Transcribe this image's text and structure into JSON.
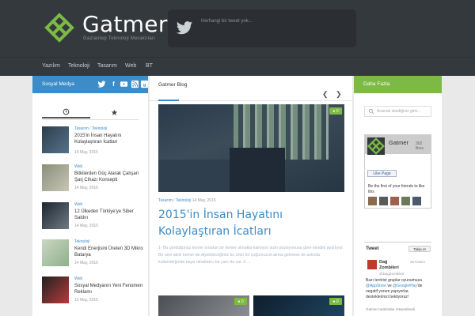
{
  "header": {
    "brand": "Gatmer",
    "tagline": "Gaziantep Teknoloji Meraklıları",
    "tweet": "Herhangi bir tweet yok..."
  },
  "nav": [
    "Yazılım",
    "Teknoloji",
    "Tasarım",
    "Web",
    "BT"
  ],
  "left": {
    "title": "Sosyal Medya",
    "social_icons": [
      "twitter-icon",
      "facebook-icon",
      "youtube-icon",
      "rss-icon",
      "google-plus-icon"
    ],
    "tabs": [
      "clock-icon",
      "star-icon"
    ],
    "posts": [
      {
        "cat_a": "Tasarım",
        "sep": " / ",
        "cat_b": "Teknoloji",
        "title": "2015'in İnsan Hayatını Kolaylaştıran İcatları",
        "date": "14 May, 2015"
      },
      {
        "cat_a": "Web",
        "sep": "",
        "cat_b": "",
        "title": "Bitkilerden Güç Alarak Çalışan Şarj Cihazı Konsepti",
        "date": "14 May, 2015"
      },
      {
        "cat_a": "Web",
        "sep": "",
        "cat_b": "",
        "title": "12 Ülkeden Türkiye'ye Siber Saldırı",
        "date": "14 May, 2015"
      },
      {
        "cat_a": "Teknoloji",
        "sep": "",
        "cat_b": "",
        "title": "Kendi Enerjisini Üreten 3D Mikro Batarya",
        "date": "14 May, 2015"
      },
      {
        "cat_a": "Web",
        "sep": "",
        "cat_b": "",
        "title": "Sosyal Medyanın Yeni Fenomen Reklamı",
        "date": "13 May, 2015"
      }
    ]
  },
  "main": {
    "title": "Gatmer Blog",
    "comment_count": "0",
    "meta_cat_a": "Tasarım",
    "meta_sep": " / ",
    "meta_cat_b": "Teknoloji",
    "meta_date": "14 May, 2015",
    "headline": "2015'in İnsan Hayatını Kolaylaştıran İcatları",
    "excerpt": "1- Bu gördüğünüz kemer sıradan bir kemer olmakla kalmıyor sizin pozisyonuna göre kendini ayarlıyor. Bir nevi akıllı kemer de diyebileceğimiz bu ürün bir çoğumuzun akına gelmese de aslında kullanıldığında baya rahatlatıcı bir yanı da var. 2-…",
    "thumb_counts": [
      "0",
      "0"
    ]
  },
  "right": {
    "title": "Daha Fazla",
    "search_placeholder": "Aramak istediğiniz girin...",
    "fb_name": "Gatmer",
    "fb_likes": "302 likes",
    "fb_like_btn": "Like Page",
    "fb_friends": "Be the first of your friends to like this",
    "tw_title": "Tweet",
    "tw_follow": "Takip et",
    "tw_name": "Dağ Zombileri",
    "tw_handle": "@DagZombileri",
    "tw_date": "26 Kasım",
    "tw_body_1": "Bazı terörist gruplar oyunumuza ",
    "tw_body_2": "@AppStore",
    "tw_body_3": " ve ",
    "tw_body_4": "@GooglePlay",
    "tw_body_5": "'de negatif yorum yapıyorlar, desteklerinizi bekliyoruz!",
    "tw_foot": "Gatmer tarafından retweetlendi"
  },
  "colors": {
    "header_bg": "#34393d",
    "blue": "#3d8cc7",
    "green": "#7cba45"
  }
}
